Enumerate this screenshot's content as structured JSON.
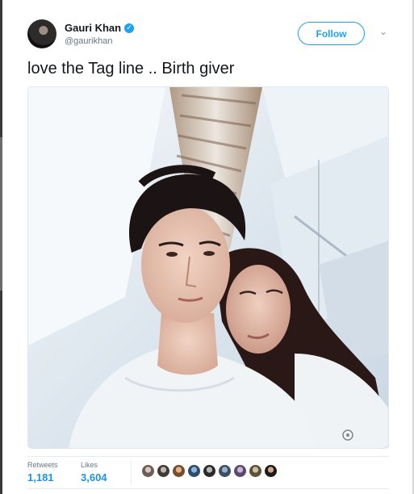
{
  "tweet": {
    "author": {
      "display_name": "Gauri Khan",
      "handle": "@gaurikhan",
      "verified": true,
      "avatar_icon": "profile-photo"
    },
    "follow_label": "Follow",
    "menu_icon": "chevron-down-icon",
    "text": "love the Tag line .. Birth giver",
    "media": {
      "type": "photo"
    },
    "stats": {
      "retweets_label": "Retweets",
      "retweets_value": "1,181",
      "likes_label": "Likes",
      "likes_value": "3,604"
    },
    "likers_count": 9
  },
  "colors": {
    "accent": "#1da1f2",
    "stat_value": "#1b95e0",
    "muted": "#657786",
    "text": "#14171a"
  }
}
